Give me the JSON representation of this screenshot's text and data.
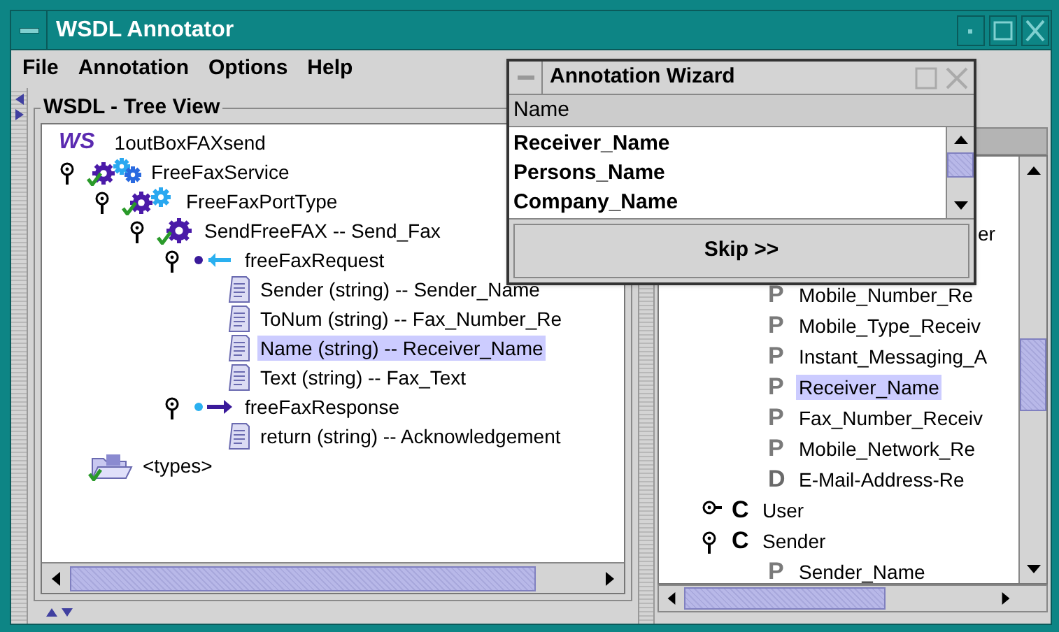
{
  "window": {
    "title": "WSDL Annotator"
  },
  "menu": [
    "File",
    "Annotation",
    "Options",
    "Help"
  ],
  "tree_view": {
    "title": "WSDL - Tree View",
    "root": {
      "kind": "ws",
      "logo_text": "WS",
      "label": "1outBoxFAXsend",
      "selected": false,
      "children": [
        {
          "kind": "service",
          "label": "FreeFaxService",
          "expanded": true,
          "selected": false,
          "children": [
            {
              "kind": "porttype",
              "label": "FreeFaxPortType",
              "expanded": true,
              "selected": false,
              "children": [
                {
                  "kind": "operation",
                  "label": "SendFreeFAX -- Send_Fax",
                  "expanded": true,
                  "selected": false,
                  "children": [
                    {
                      "kind": "input",
                      "label": "freeFaxRequest",
                      "expanded": true,
                      "selected": false,
                      "children": [
                        {
                          "kind": "part",
                          "label": "Sender (string) -- Sender_Name",
                          "selected": false
                        },
                        {
                          "kind": "part",
                          "label": "ToNum (string) -- Fax_Number_Re",
                          "selected": false
                        },
                        {
                          "kind": "part",
                          "label": "Name (string) -- Receiver_Name",
                          "selected": true
                        },
                        {
                          "kind": "part",
                          "label": "Text (string) -- Fax_Text",
                          "selected": false
                        }
                      ]
                    },
                    {
                      "kind": "output",
                      "label": "freeFaxResponse",
                      "expanded": true,
                      "selected": false,
                      "children": [
                        {
                          "kind": "part",
                          "label": "return (string) -- Acknowledgement",
                          "selected": false
                        }
                      ]
                    }
                  ]
                }
              ]
            }
          ]
        },
        {
          "kind": "types",
          "label": "<types>",
          "selected": false
        }
      ]
    }
  },
  "ontology_view": {
    "clipped_row": {
      "label": "er",
      "children": [
        {
          "kind": "property",
          "badge": "P",
          "label": "Mobile_Number_Re",
          "selected": false
        },
        {
          "kind": "property",
          "badge": "P",
          "label": "Mobile_Type_Receiv",
          "selected": false
        },
        {
          "kind": "property",
          "badge": "P",
          "label": "Instant_Messaging_A",
          "selected": false
        },
        {
          "kind": "property",
          "badge": "P",
          "label": "Receiver_Name",
          "selected": true
        },
        {
          "kind": "property",
          "badge": "P",
          "label": "Fax_Number_Receiv",
          "selected": false
        },
        {
          "kind": "property",
          "badge": "P",
          "label": "Mobile_Network_Re",
          "selected": false
        },
        {
          "kind": "datatype",
          "badge": "D",
          "label": "E-Mail-Address-Re",
          "selected": false
        }
      ]
    },
    "nodes": [
      {
        "kind": "class",
        "badge": "C",
        "label": "User",
        "expanded": false,
        "selected": false
      },
      {
        "kind": "class",
        "badge": "C",
        "label": "Sender",
        "expanded": true,
        "selected": false,
        "children": [
          {
            "kind": "property",
            "badge": "P",
            "label": "Sender_Name",
            "selected": false
          }
        ]
      }
    ]
  },
  "wizard": {
    "title": "Annotation Wizard",
    "column": "Name",
    "options": [
      "Receiver_Name",
      "Persons_Name",
      "Company_Name"
    ],
    "button": "Skip >>"
  }
}
